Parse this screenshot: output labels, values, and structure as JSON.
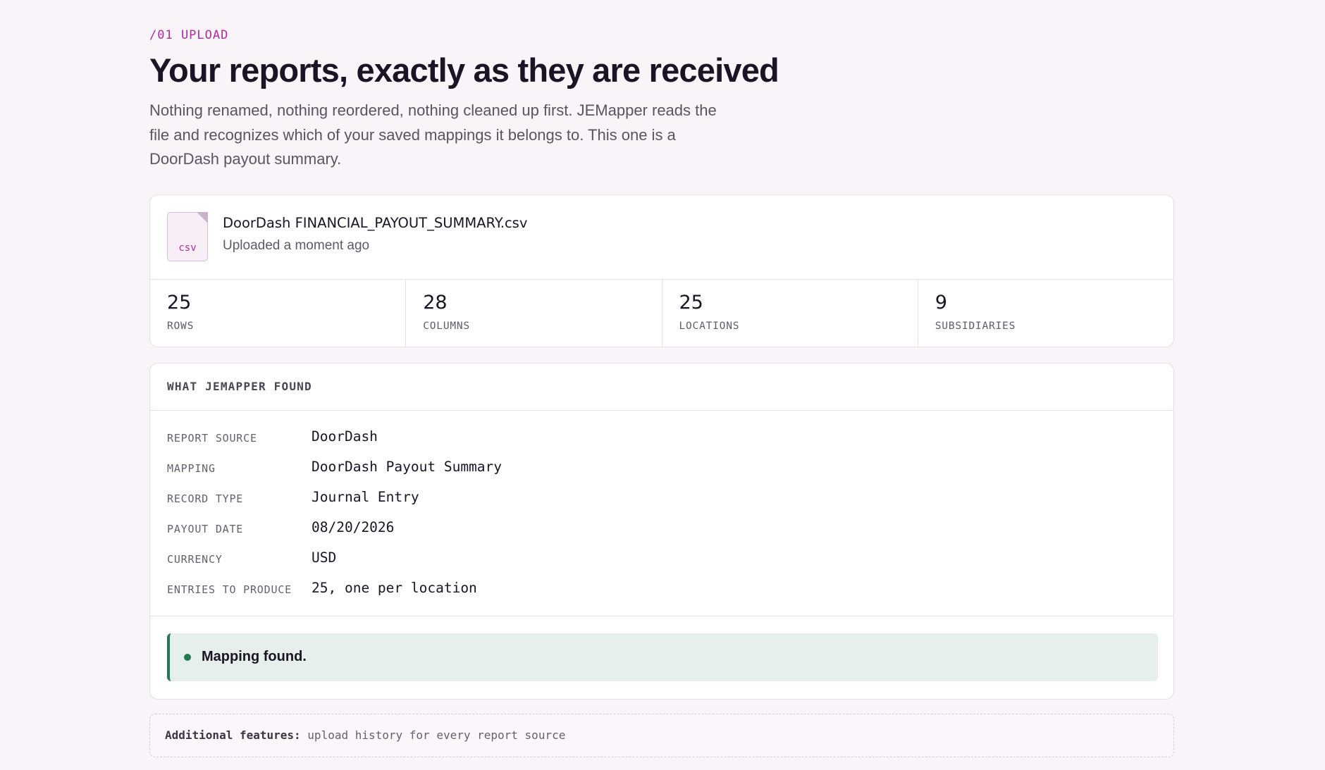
{
  "section": {
    "eyebrow": "/01 UPLOAD",
    "title": "Your reports, exactly as they are received",
    "description": "Nothing renamed, nothing reordered, nothing cleaned up first. JEMapper reads the file and recognizes which of your saved mappings it belongs to. This one is a DoorDash payout summary."
  },
  "file": {
    "icon": "csv-file-icon",
    "extension": "csv",
    "name": "DoorDash FINANCIAL_PAYOUT_SUMMARY.csv",
    "uploaded": "Uploaded a moment ago"
  },
  "stats": [
    {
      "value": "25",
      "label": "ROWS"
    },
    {
      "value": "28",
      "label": "COLUMNS"
    },
    {
      "value": "25",
      "label": "LOCATIONS"
    },
    {
      "value": "9",
      "label": "SUBSIDIARIES"
    }
  ],
  "found": {
    "header": "WHAT JEMAPPER FOUND",
    "fields": [
      {
        "key": "REPORT SOURCE",
        "value": "DoorDash"
      },
      {
        "key": "MAPPING",
        "value": "DoorDash Payout Summary"
      },
      {
        "key": "RECORD TYPE",
        "value": "Journal Entry"
      },
      {
        "key": "PAYOUT DATE",
        "value": "08/20/2026"
      },
      {
        "key": "CURRENCY",
        "value": "USD"
      },
      {
        "key": "ENTRIES TO PRODUCE",
        "value": "25, one per location"
      }
    ],
    "status": "Mapping found.",
    "status_color": "#1f7a4e"
  },
  "additional": {
    "label": "Additional features:",
    "text": "upload history for every report source"
  },
  "colors": {
    "accent": "#b02aa3",
    "background": "#f9f4f8",
    "success": "#1f7a4e"
  }
}
